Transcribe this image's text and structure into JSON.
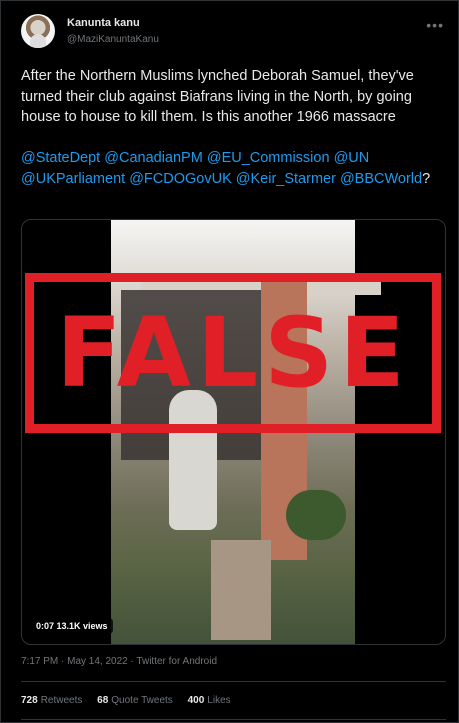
{
  "author": {
    "display_name": "Kanunta kanu",
    "handle": "@MaziKanuntaKanu"
  },
  "more_icon": "more-horizontal-icon",
  "tweet_text": "After the Northern Muslims lynched Deborah Samuel, they've turned their club against Biafrans living in the North, by going house to house to kill them. Is this another 1966 massacre",
  "mentions": [
    "@StateDept",
    "@CanadianPM",
    "@EU_Commission",
    "@UN",
    "@UKParliament",
    "@FCDOGovUK",
    "@Keir_Starmer",
    "@BBCWorld"
  ],
  "mentions_suffix": "?",
  "media": {
    "overlay_label": "FALSE",
    "duration": "0:07",
    "views": "13.1K views"
  },
  "meta": "7:17 PM · May 14, 2022 · Twitter for Android",
  "stats": {
    "retweets_count": "728",
    "retweets_label": "Retweets",
    "quotes_count": "68",
    "quotes_label": "Quote Tweets",
    "likes_count": "400",
    "likes_label": "Likes"
  },
  "colors": {
    "accent": "#1d9bf0",
    "overlay_red": "#e11f27",
    "background": "#000000"
  }
}
